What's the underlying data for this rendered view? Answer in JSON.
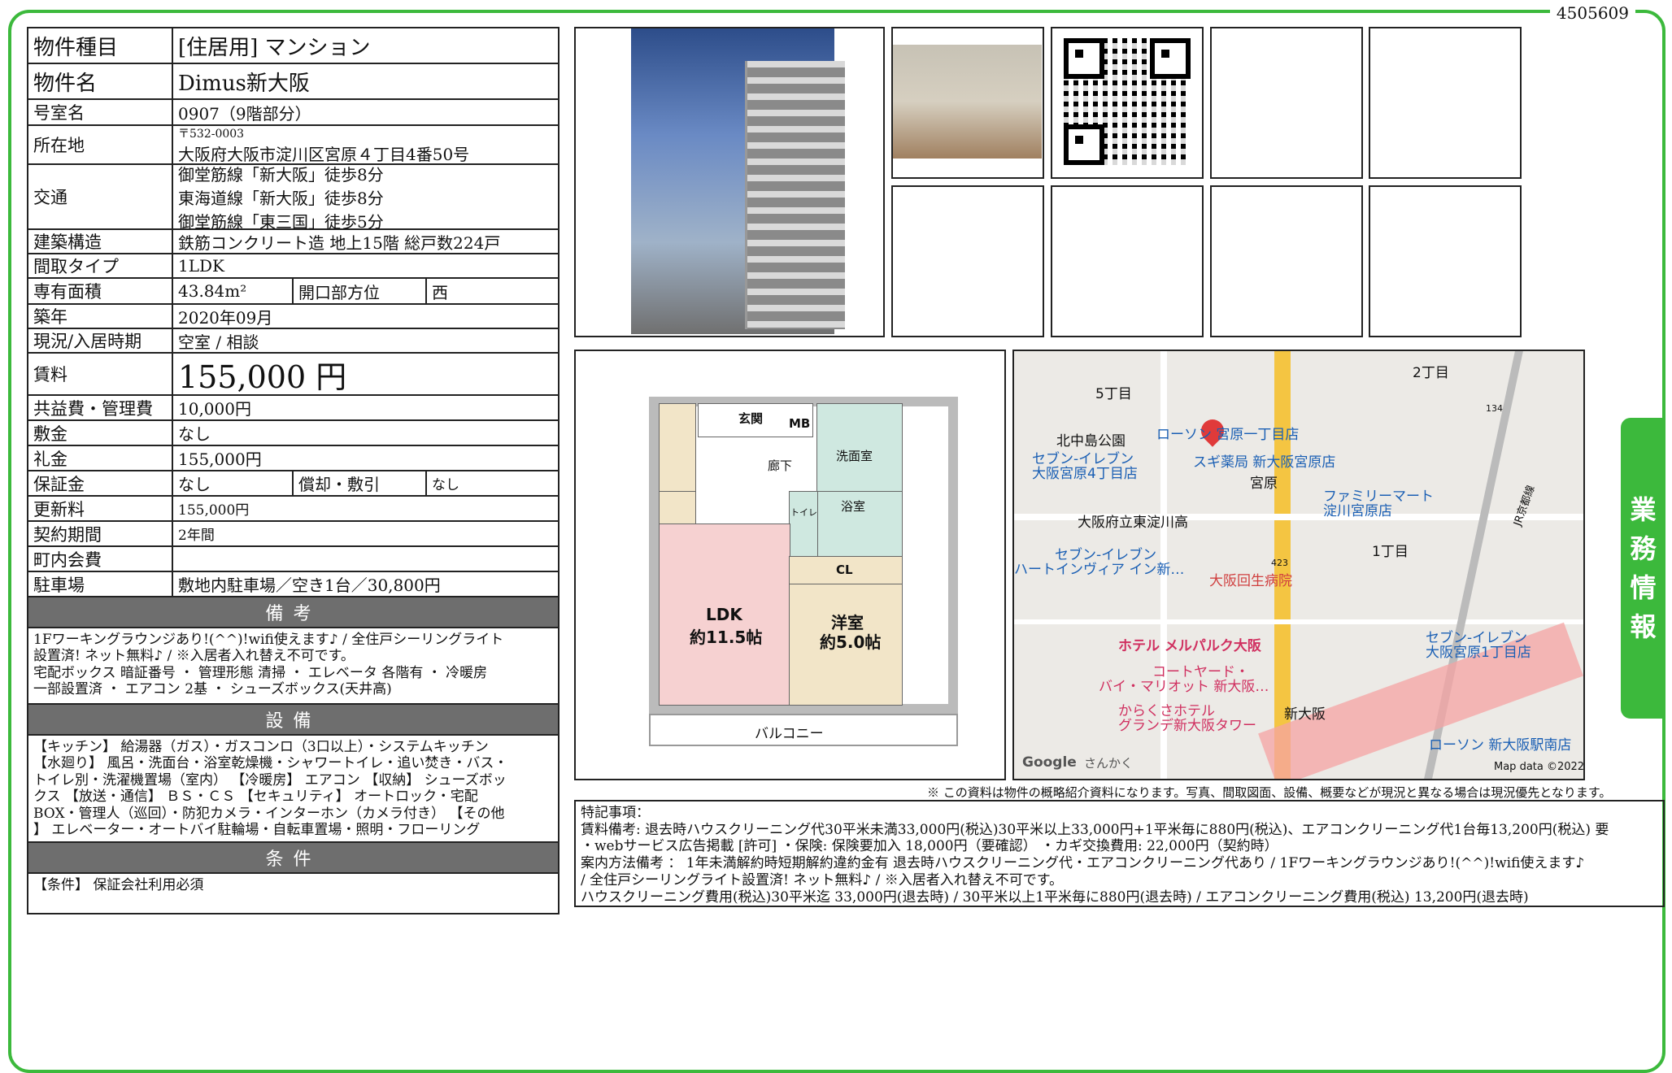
{
  "doc_id": "4505609",
  "property": {
    "type_label": "物件種目",
    "type_value": "[住居用] マンション",
    "name_label": "物件名",
    "name_value": "Dimus新大阪",
    "room_label": "号室名",
    "room_value": "0907（9階部分）",
    "address_label": "所在地",
    "address_zip": "〒532-0003",
    "address_value": "大阪府大阪市淀川区宮原４丁目4番50号",
    "access_label": "交通",
    "access": [
      "御堂筋線「新大阪」徒歩8分",
      "東海道線「新大阪」徒歩8分",
      "御堂筋線「東三国」徒歩5分"
    ],
    "structure_label": "建築構造",
    "structure_value": "鉄筋コンクリート造 地上15階 総戸数224戸",
    "layout_label": "間取タイプ",
    "layout_value": "1LDK",
    "area_label": "専有面積",
    "area_value": "43.84m²",
    "opening_label": "開口部方位",
    "opening_value": "西",
    "built_label": "築年",
    "built_value": "2020年09月",
    "status_label": "現況/入居時期",
    "status_value": "空室 / 相談",
    "rent_label": "賃料",
    "rent_value": "155,000 円",
    "fee_label": "共益費・管理費",
    "fee_value": "10,000円",
    "deposit_label": "敷金",
    "deposit_value": "なし",
    "keymoney_label": "礼金",
    "keymoney_value": "155,000円",
    "guarantee_label": "保証金",
    "guarantee_value": "なし",
    "amort_label": "償却・敷引",
    "amort_value": "なし",
    "renewal_label": "更新料",
    "renewal_value": "155,000円",
    "contract_label": "契約期間",
    "contract_value": "2年間",
    "community_label": "町内会費",
    "community_value": "",
    "parking_label": "駐車場",
    "parking_value": "敷地内駐車場／空き1台／30,800円"
  },
  "sections": {
    "remarks_head": "備考",
    "remarks_lines": [
      "1Fワーキングラウンジあり!(^^)!wifi使えます♪ / 全住戸シーリングライト",
      "設置済! ネット無料♪ / ※入居者入れ替え不可です。",
      "宅配ボックス 暗証番号 ・ 管理形態 清掃 ・ エレベータ 各階有 ・ 冷暖房",
      "一部設置済 ・ エアコン 2基 ・ シューズボックス(天井高)"
    ],
    "facilities_head": "設備",
    "facilities_lines": [
      "【キッチン】 給湯器（ガス）・ガスコンロ（3口以上）・システムキッチン",
      "【水廻り】 風呂・洗面台・浴室乾燥機・シャワートイレ・追い焚き・バス・",
      "トイレ別・洗濯機置場（室内） 【冷暖房】 エアコン 【収納】 シューズボッ",
      "クス 【放送・通信】 ＢＳ・ＣＳ 【セキュリティ】 オートロック・宅配",
      "BOX・管理人（巡回）・防犯カメラ・インターホン（カメラ付き） 【その他",
      "】 エレベーター・オートバイ駐輪場・自転車置場・照明・フローリング"
    ],
    "conditions_head": "条件",
    "conditions_lines": [
      "【条件】 保証会社利用必須"
    ]
  },
  "floorplan": {
    "genkan": "玄関",
    "mb": "MB",
    "rouka": "廊下",
    "senmen": "洗面室",
    "yokushitsu": "浴室",
    "toilet": "トイレ",
    "cl": "CL",
    "ldk": "LDK",
    "ldk_size": "約11.5帖",
    "youshitsu": "洋室",
    "youshitsu_size": "約5.0帖",
    "balcony": "バルコニー"
  },
  "map": {
    "labels": [
      "5丁目",
      "2丁目",
      "北中島公園",
      "ローソン 宮原一丁目店",
      "セブン-イレブン",
      "大阪宮原4丁目店",
      "スギ薬局 新大阪宮原店",
      "宮原",
      "ファミリーマート",
      "淀川宮原店",
      "大阪府立東淀川高",
      "セブン-イレブン",
      "ハートインヴィア イン新…",
      "1丁目",
      "大阪回生病院",
      "ホテル メルパルク大阪",
      "コートヤード・",
      "バイ・マリオット 新大阪…",
      "からくさホテル",
      "グランデ新大阪タワー",
      "新大阪",
      "セブン-イレブン",
      "大阪宮原1丁目店",
      "ローソン 新大阪駅南店",
      "134",
      "423",
      "JR京都線"
    ],
    "google": "Google",
    "sankaku": "さんかく",
    "map_data": "Map data ©2022"
  },
  "disclaimer": "※ この資料は物件の概略紹介資料になります。写真、間取図面、設備、概要などが現況と異なる場合は現況優先となります。",
  "special_notes": {
    "title": "特記事項：",
    "lines": [
      "賃料備考: 退去時ハウスクリーニング代30平米未満33,000円(税込)30平米以上33,000円+1平米毎に880円(税込)、エアコンクリーニング代1台毎13,200円(税込) 要",
      "・webサービス広告掲載 [許可] ・保険: 保険要加入 18,000円（要確認） ・カギ交換費用: 22,000円（契約時）",
      "案内方法備考 ： 1年未満解約時短期解約違約金有 退去時ハウスクリーニング代・エアコンクリーニング代あり / 1Fワーキングラウンジあり!(^^)!wifi使えます♪",
      " / 全住戸シーリングライト設置済! ネット無料♪ / ※入居者入れ替え不可です。",
      "ハウスクリーニング費用(税込)30平米迄 33,000円(退去時) / 30平米以上1平米毎に880円(退去時) / エアコンクリーニング費用(税込) 13,200円(退去時)"
    ]
  },
  "side_tab": [
    "業",
    "務",
    "情",
    "報"
  ],
  "colors": {
    "accent_green": "#3cb93c",
    "section_gray": "#6e6e6e"
  }
}
